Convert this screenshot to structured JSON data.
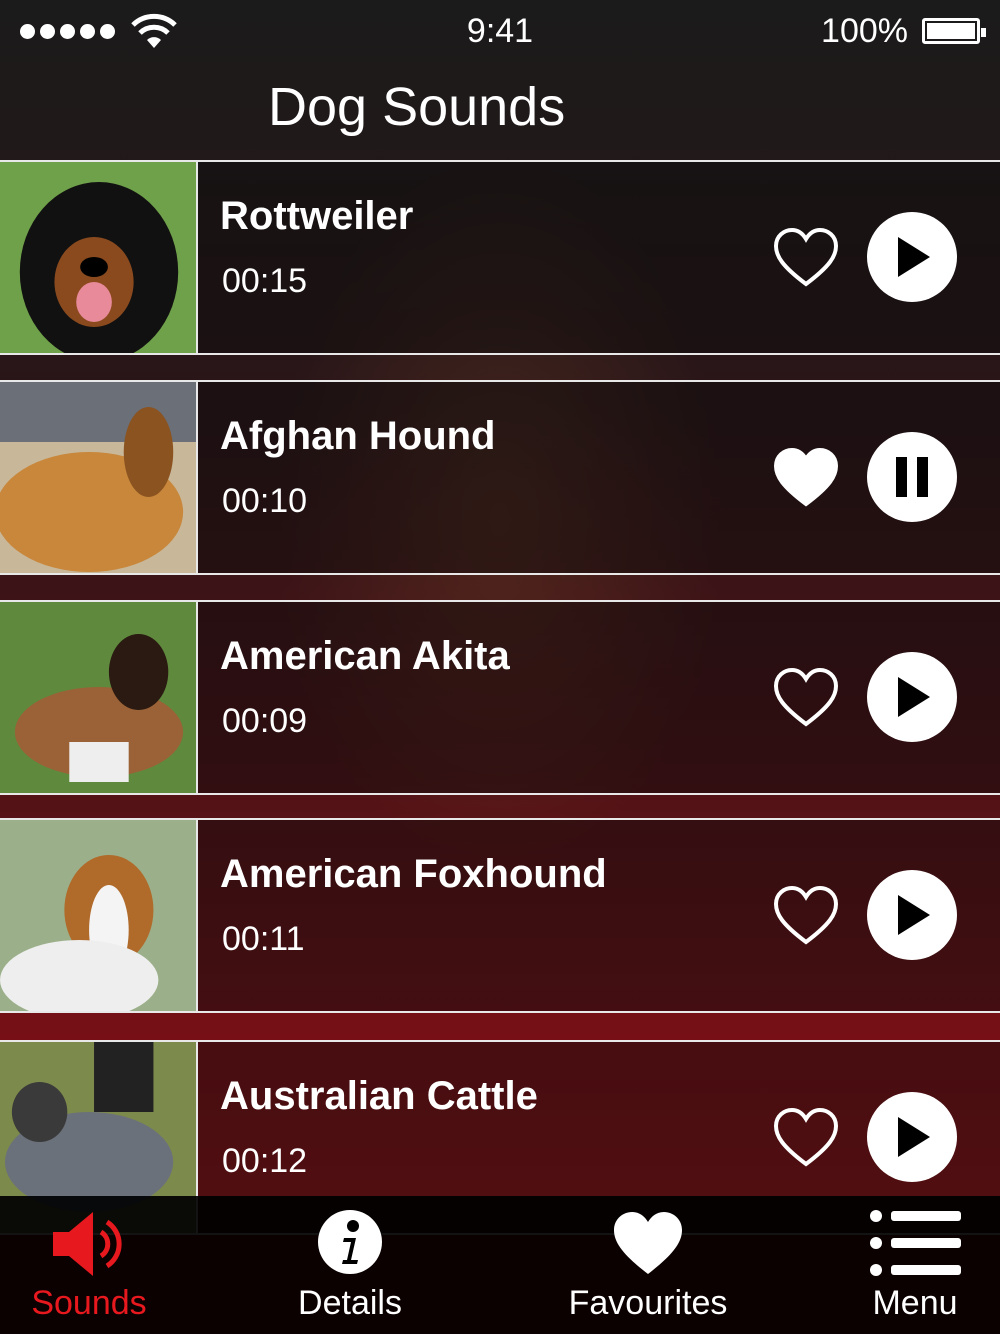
{
  "status_bar": {
    "time": "9:41",
    "battery": "100%"
  },
  "header": {
    "title": "Dog Sounds"
  },
  "sounds": [
    {
      "name": "Rottweiler",
      "duration": "00:15",
      "favourite": false,
      "playing": false
    },
    {
      "name": "Afghan Hound",
      "duration": "00:10",
      "favourite": true,
      "playing": true
    },
    {
      "name": "American Akita",
      "duration": "00:09",
      "favourite": false,
      "playing": false
    },
    {
      "name": "American Foxhound",
      "duration": "00:11",
      "favourite": false,
      "playing": false
    },
    {
      "name": "Australian Cattle",
      "duration": "00:12",
      "favourite": false,
      "playing": false
    }
  ],
  "tabs": [
    {
      "label": "Sounds",
      "icon": "speaker-icon",
      "active": true
    },
    {
      "label": "Details",
      "icon": "info-icon",
      "active": false
    },
    {
      "label": "Favourites",
      "icon": "heart-icon",
      "active": false
    },
    {
      "label": "Menu",
      "icon": "menu-list-icon",
      "active": false
    }
  ],
  "colors": {
    "accent": "#e8191e",
    "background_bottom": "#9c1418"
  }
}
